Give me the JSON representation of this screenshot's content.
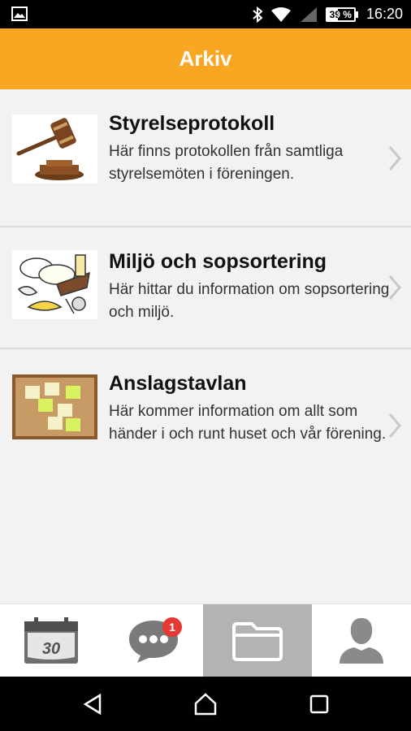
{
  "status_bar": {
    "battery": "39 %",
    "time": "16:20",
    "icons": [
      "image-icon",
      "bluetooth-icon",
      "wifi-icon",
      "signal-icon",
      "battery-icon"
    ]
  },
  "header": {
    "title": "Arkiv"
  },
  "items": [
    {
      "title": "Styrelseprotokoll",
      "description": "Här finns protokollen från samtliga styrelsemöten i föreningen.",
      "icon": "gavel-image"
    },
    {
      "title": "Miljö och sopsortering",
      "description": "Här hittar du information om sopsortering och miljö.",
      "icon": "garbage-image"
    },
    {
      "title": "Anslagstavlan",
      "description": "Här kommer information om allt som händer i och runt huset och vår förening.",
      "icon": "corkboard-image"
    }
  ],
  "tab_bar": {
    "calendar_day": "30",
    "message_badge": "1",
    "active_tab": "archive"
  },
  "colors": {
    "accent": "#f9a623",
    "background": "#f2f2f2",
    "active_tab": "#b3b3b3",
    "badge": "#e53935"
  }
}
